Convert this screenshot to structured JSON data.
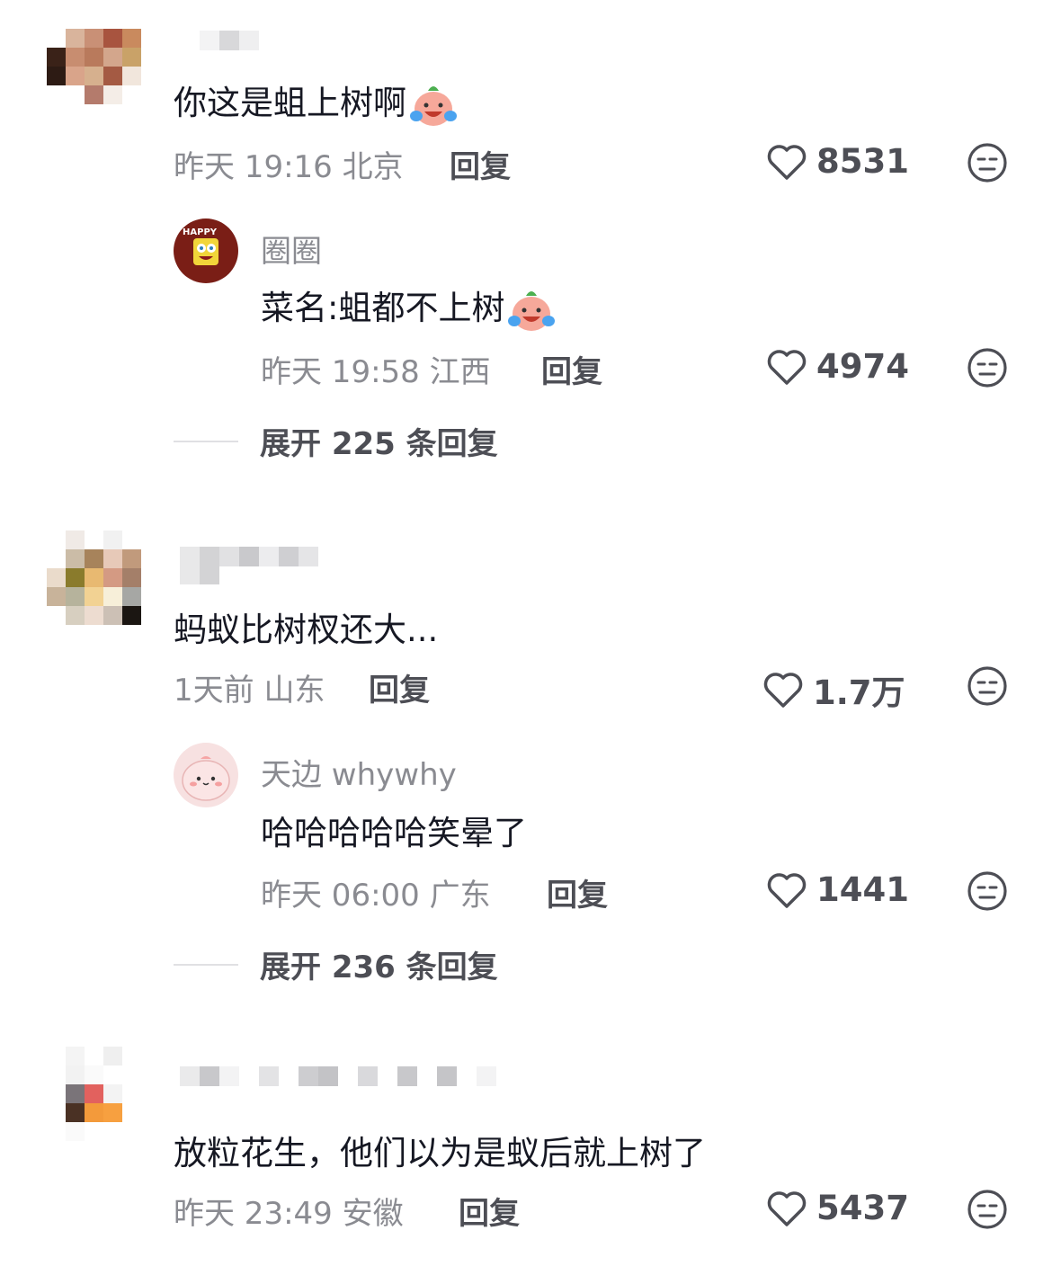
{
  "comments": [
    {
      "text": "你这是蛆上树啊",
      "time": "昨天 19:16 北京",
      "reply_label": "回复",
      "likes": "8531",
      "reply": {
        "username": "圈圈",
        "text": "菜名:蛆都不上树",
        "time": "昨天 19:58 江西",
        "reply_label": "回复",
        "likes": "4974"
      },
      "expand_label": "展开 225 条回复"
    },
    {
      "text": "蚂蚁比树杈还大...",
      "time": "1天前 山东",
      "reply_label": "回复",
      "likes": "1.7万",
      "reply": {
        "username": "天边 whywhy",
        "text": "哈哈哈哈哈笑晕了",
        "time": "昨天 06:00 广东",
        "reply_label": "回复",
        "likes": "1441"
      },
      "expand_label": "展开 236 条回复"
    },
    {
      "text": "放粒花生，他们以为是蚁后就上树了",
      "time": "昨天 23:49 安徽",
      "reply_label": "回复",
      "likes": "5437"
    }
  ],
  "icons": {
    "like": "heart-outline-icon",
    "dislike": "neutral-face-icon",
    "emoji": "crying-laughing-emoji"
  },
  "colors": {
    "text": "#161823",
    "meta": "#8a8b91",
    "action": "#4d4e55"
  }
}
